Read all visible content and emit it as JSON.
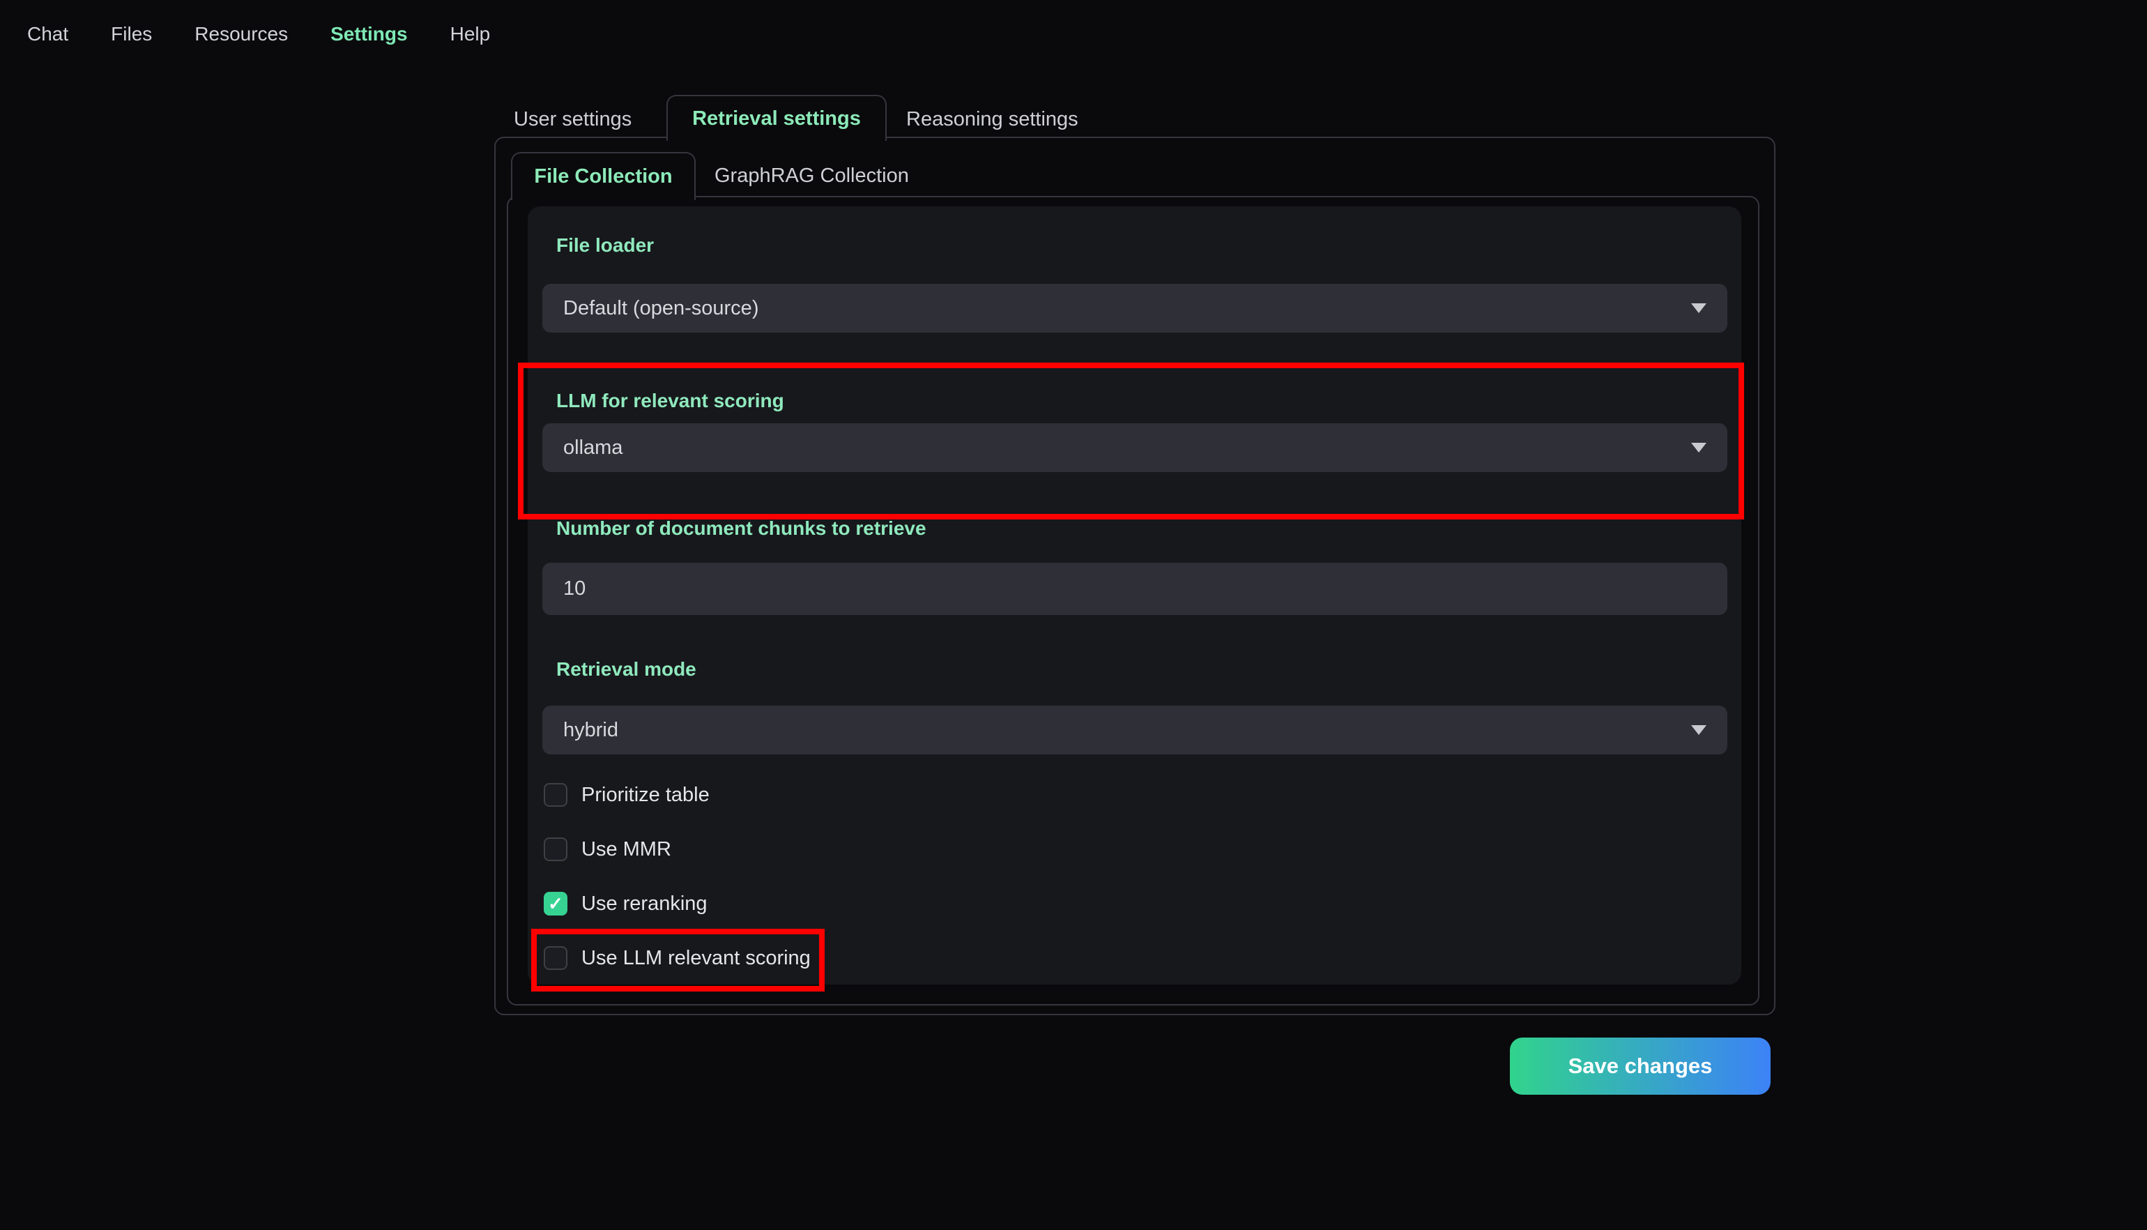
{
  "nav": {
    "items": [
      {
        "label": "Chat",
        "active": false
      },
      {
        "label": "Files",
        "active": false
      },
      {
        "label": "Resources",
        "active": false
      },
      {
        "label": "Settings",
        "active": true
      },
      {
        "label": "Help",
        "active": false
      }
    ]
  },
  "settings_tabs": {
    "items": [
      {
        "label": "User settings",
        "active": false
      },
      {
        "label": "Retrieval settings",
        "active": true
      },
      {
        "label": "Reasoning settings",
        "active": false
      }
    ]
  },
  "collection_tabs": {
    "items": [
      {
        "label": "File Collection",
        "active": true
      },
      {
        "label": "GraphRAG Collection",
        "active": false
      }
    ]
  },
  "form": {
    "file_loader": {
      "label": "File loader",
      "value": "Default (open-source)"
    },
    "llm_scoring": {
      "label": "LLM for relevant scoring",
      "value": "ollama"
    },
    "num_chunks": {
      "label": "Number of document chunks to retrieve",
      "value": "10"
    },
    "retrieval_mode": {
      "label": "Retrieval mode",
      "value": "hybrid"
    },
    "checkboxes": [
      {
        "label": "Prioritize table",
        "checked": false
      },
      {
        "label": "Use MMR",
        "checked": false
      },
      {
        "label": "Use reranking",
        "checked": true
      },
      {
        "label": "Use LLM relevant scoring",
        "checked": false
      }
    ]
  },
  "actions": {
    "save_label": "Save changes"
  },
  "icons": {
    "check": "✓"
  },
  "colors": {
    "accent_green": "#8fe9bd",
    "checkbox_checked": "#36d392",
    "annotation_red": "#ff0000",
    "button_gradient_start": "#31d38c",
    "button_gradient_end": "#3c82f7",
    "panel_border": "#35363d",
    "card_bg": "#17181c",
    "field_bg": "#2e2f37"
  }
}
